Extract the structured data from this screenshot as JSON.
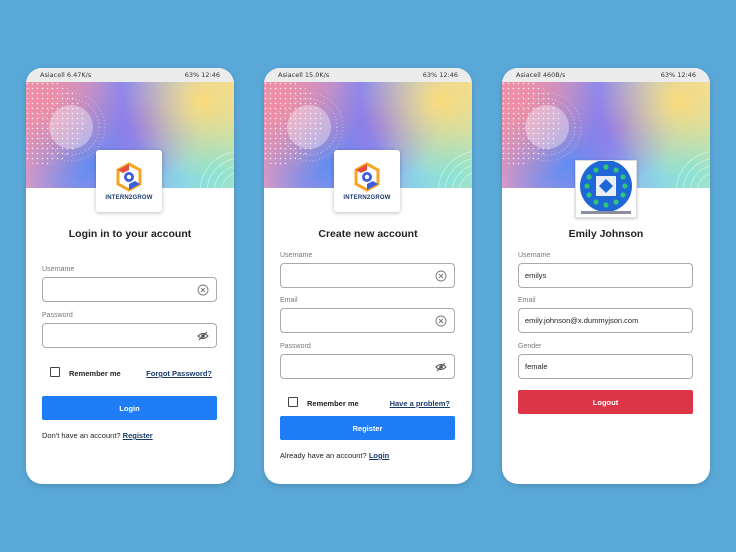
{
  "status_bars": [
    {
      "carrier": "Asiacell",
      "speed": "6.47K/s",
      "right": "63%  12:46"
    },
    {
      "carrier": "Asiacell",
      "speed": "15.0K/s",
      "right": "63%  12:46"
    },
    {
      "carrier": "Asiacell",
      "speed": "460B/s",
      "right": "63%  12:46"
    }
  ],
  "brand": {
    "logo_text": "INTERN2GROW"
  },
  "login": {
    "title": "Login in to your account",
    "username_label": "Username",
    "username_value": "",
    "password_label": "Password",
    "password_value": "",
    "remember_label": "Remember me",
    "forgot_link": "Forgot Password?",
    "login_button": "Login",
    "footer_text": "Don't have an account?",
    "footer_link": "Register"
  },
  "register": {
    "title": "Create new account",
    "username_label": "Username",
    "username_value": "",
    "email_label": "Email",
    "email_value": "",
    "password_label": "Password",
    "password_value": "",
    "remember_label": "Remember me",
    "problem_link": "Have a problem?",
    "register_button": "Register",
    "footer_text": "Already have an account?",
    "footer_link": "Login"
  },
  "profile": {
    "name": "Emily Johnson",
    "username_label": "Username",
    "username_value": "emilys",
    "email_label": "Email",
    "email_value": "emily.johnson@x.dummyjson.com",
    "gender_label": "Gender",
    "gender_value": "female",
    "logout_button": "Logout"
  },
  "colors": {
    "background": "#5aa8d8",
    "primary_button": "#1e7cf6",
    "danger_button": "#dc3545",
    "link": "#1a3a6b"
  },
  "icons": [
    "clear-circle-icon",
    "eye-off-icon",
    "intern2grow-logo-icon",
    "avatar-emblem-icon"
  ]
}
